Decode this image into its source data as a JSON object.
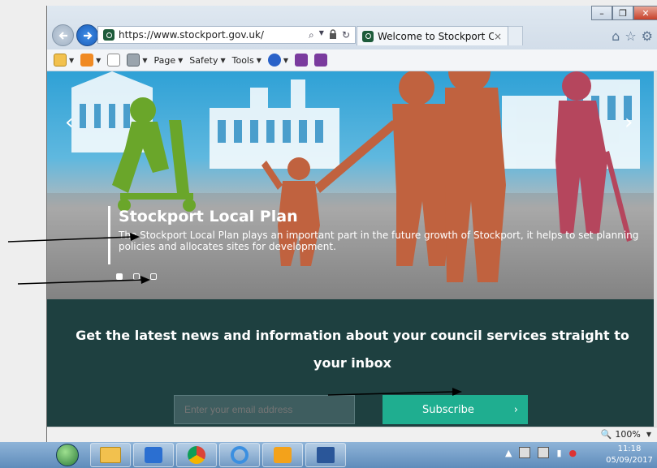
{
  "browser": {
    "url": "https://www.stockport.gov.uk/",
    "tab_title": "Welcome to Stockport Cou...",
    "tab_close": "×",
    "window_controls": {
      "minimize": "–",
      "maximize": "❐",
      "close": "✕"
    },
    "frame_icons": [
      "home-icon",
      "favorites-star-icon",
      "settings-gear-icon"
    ]
  },
  "command_bar": {
    "page": "Page",
    "safety": "Safety",
    "tools": "Tools"
  },
  "hero": {
    "title": "Stockport Local Plan",
    "text": "The Stockport Local Plan plays an important part in the future growth of Stockport, it helps to set planning policies and allocates sites for development.",
    "prev": "‹",
    "next": "›",
    "slides_total": 3,
    "slide_active": 1
  },
  "newsletter": {
    "heading": "Get the latest news and information about your council services straight to your inbox",
    "email_placeholder": "Enter your email address",
    "subscribe_label": "Subscribe",
    "subscribe_chevron": "›"
  },
  "status_bar": {
    "zoom": "100%"
  },
  "taskbar": {
    "time": "11:18",
    "date": "05/09/2017",
    "pinned": [
      "windows-explorer-icon",
      "outlook-icon",
      "chrome-icon",
      "internet-explorer-icon",
      "outlook-express-icon",
      "word-icon"
    ]
  },
  "colors": {
    "newsletter_bg": "#1e4040",
    "subscribe_bg": "#1fae90",
    "hero_sky": "#2fa1d6",
    "figure_orange": "#c0623f",
    "figure_green": "#6aa62a",
    "figure_red": "#b5465d"
  }
}
